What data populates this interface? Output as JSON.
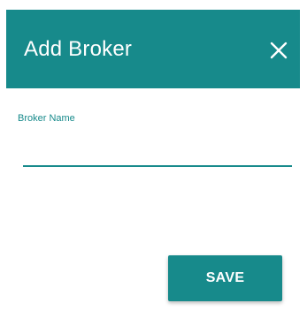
{
  "dialog": {
    "title": "Add Broker",
    "close_icon": "close-icon",
    "accent_color": "#178a8b",
    "field": {
      "label": "Broker Name",
      "value": "",
      "placeholder": ""
    },
    "save_label": "SAVE"
  }
}
